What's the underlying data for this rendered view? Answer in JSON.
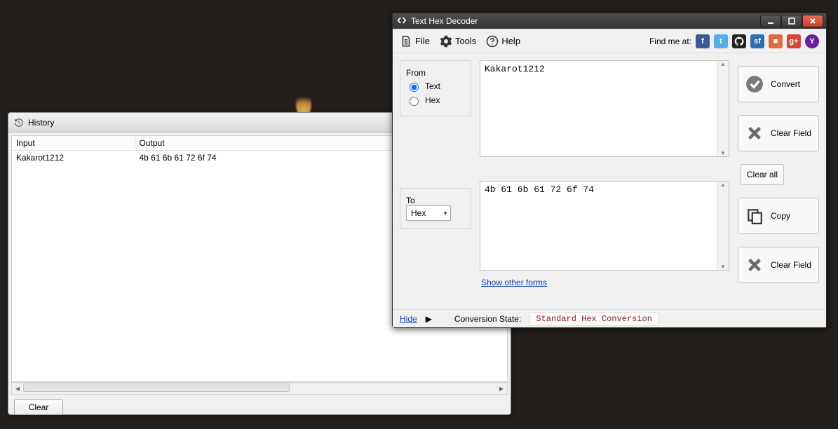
{
  "history": {
    "title": "History",
    "col_input": "Input",
    "col_output": "Output",
    "rows": [
      {
        "input": "Kakarot1212",
        "output": "4b 61 6b 61 72 6f 74"
      }
    ],
    "clear_label": "Clear"
  },
  "decoder": {
    "title": "Text Hex Decoder",
    "menu": {
      "file": "File",
      "tools": "Tools",
      "help": "Help"
    },
    "find_me": "Find me at:",
    "from_label": "From",
    "radio_text": "Text",
    "radio_hex": "Hex",
    "to_label": "To",
    "to_select": "Hex",
    "input_text": "Kakarot1212",
    "output_text": "4b 61 6b 61 72 6f 74",
    "show_other": "Show other forms",
    "convert": "Convert",
    "clear_field": "Clear Field",
    "clear_all": "Clear all",
    "copy": "Copy",
    "hide": "Hide",
    "conv_state_label": "Conversion State:",
    "conv_state_value": "Standard Hex Conversion"
  }
}
